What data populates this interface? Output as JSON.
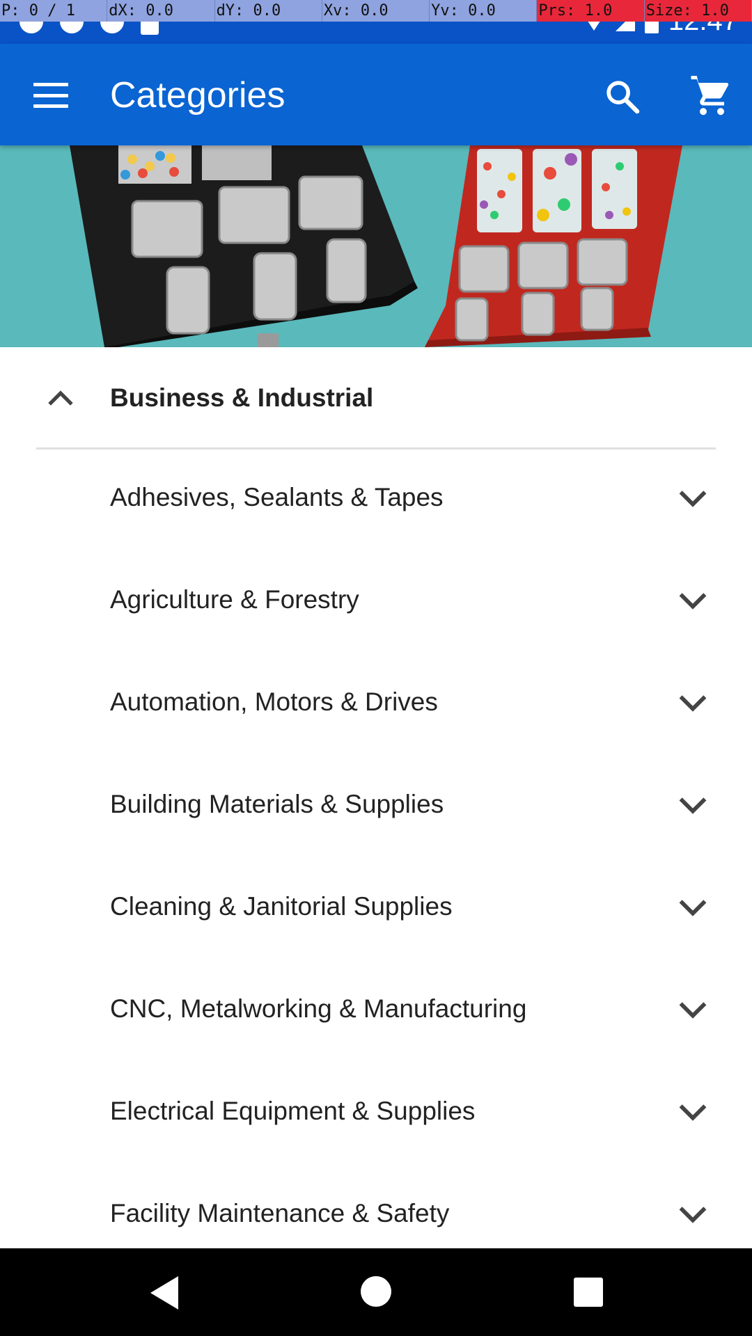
{
  "debug": {
    "pointer": "P: 0 / 1",
    "dx": "dX: 0.0",
    "dy": "dY: 0.0",
    "xv": "Xv: 0.0",
    "yv": "Yv: 0.0",
    "prs": "Prs: 1.0",
    "size": "Size: 1.0"
  },
  "status_bar": {
    "time": "12:47",
    "icons": [
      "notification-icon",
      "sync-icon",
      "circle-notification-icon",
      "sd-card-icon",
      "wifi-icon",
      "signal-icon",
      "battery-icon"
    ]
  },
  "app_bar": {
    "title": "Categories",
    "icons": [
      "menu-icon",
      "search-icon",
      "cart-icon"
    ]
  },
  "category": {
    "parent_label": "Business & Industrial",
    "expanded": true,
    "children": [
      {
        "label": "Adhesives, Sealants & Tapes"
      },
      {
        "label": "Agriculture & Forestry"
      },
      {
        "label": "Automation, Motors & Drives"
      },
      {
        "label": "Building Materials & Supplies"
      },
      {
        "label": "Cleaning & Janitorial Supplies"
      },
      {
        "label": "CNC, Metalworking & Manufacturing"
      },
      {
        "label": "Electrical Equipment & Supplies"
      },
      {
        "label": "Facility Maintenance & Safety"
      }
    ]
  },
  "colors": {
    "status_bar": "#0a53c7",
    "app_bar": "#0a64d2",
    "banner_bg": "#5ab9bb",
    "debug_bar": "#8fa3e0",
    "debug_alert": "#e8283a"
  }
}
